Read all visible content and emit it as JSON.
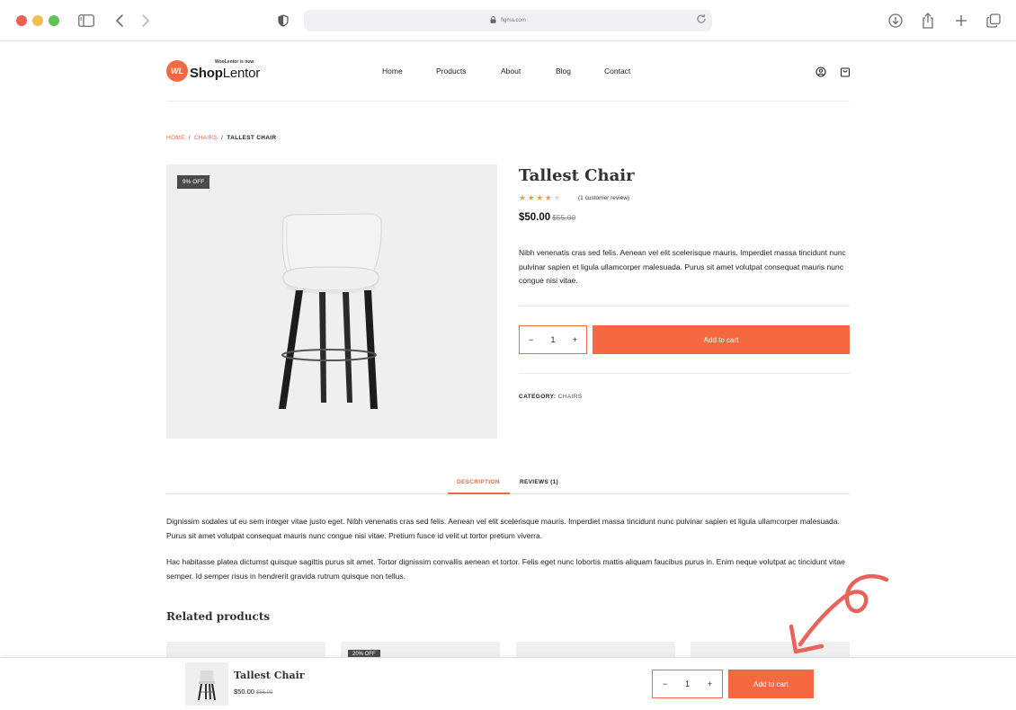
{
  "browser": {
    "url": "figma.com"
  },
  "logo": {
    "tagline": "WooLentor is now",
    "badge": "WL",
    "name_bold": "Shop",
    "name_rest": "Lentor"
  },
  "nav": {
    "items": [
      "Home",
      "Products",
      "About",
      "Blog",
      "Contact"
    ]
  },
  "breadcrumb": {
    "home": "HOME",
    "sep": "/",
    "category": "CHAIRS",
    "current": "TALLEST CHAIR"
  },
  "product": {
    "badge": "9% OFF",
    "title": "Tallest Chair",
    "rating": 4,
    "rating_max": 5,
    "review_text": "(1 customer review)",
    "price": "$50.00",
    "price_old": "$55.00",
    "short_description": "Nibh venenatis cras sed felis. Aenean vel elit scelerisque mauris. Imperdiet massa tincidunt nunc pulvinar sapien et ligula ullamcorper malesuada. Purus sit amet volutpat consequat mauris nunc congue nisi vitae.",
    "quantity": "1",
    "minus": "−",
    "plus": "+",
    "add_to_cart": "Add to cart",
    "category_label": "CATEGORY:",
    "category_value": "CHAIRS"
  },
  "tabs": {
    "description": "DESCRIPTION",
    "reviews": "REVIEWS (1)"
  },
  "description": {
    "p1": "Dignissim sodales ut eu sem integer vitae justo eget. Nibh venenatis cras sed felis. Aenean vel elit scelerisque mauris. Imperdiet massa tincidunt nunc pulvinar sapien et ligula ullamcorper malesuada. Purus sit amet volutpat consequat mauris nunc congue nisi vitae. Pretium fusce id velit ut tortor pretium viverra.",
    "p2": "Hac habitasse platea dictumst quisque sagittis purus sit amet. Tortor dignissim convallis aenean et tortor. Felis eget nunc lobortis mattis aliquam faucibus purus in. Enim neque volutpat ac tincidunt vitae semper. Id semper risus in hendrerit gravida rutrum quisque non tellus."
  },
  "related": {
    "heading": "Related products",
    "badge": "20% OFF"
  },
  "sticky": {
    "title": "Tallest Chair",
    "price": "$50.00",
    "price_old": "$55.00",
    "quantity": "1",
    "minus": "−",
    "plus": "+",
    "add_to_cart": "Add to cart"
  },
  "colors": {
    "accent": "#f26a43",
    "button": "#f46842",
    "star": "#f1a23d",
    "annotation_arrow": "#e8645a"
  }
}
